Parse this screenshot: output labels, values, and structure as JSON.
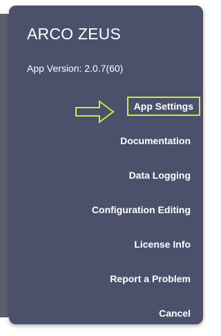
{
  "dialog": {
    "title": "ARCO ZEUS",
    "version": "App Version: 2.0.7(60)"
  },
  "menu": {
    "items": [
      {
        "label": "App Settings"
      },
      {
        "label": "Documentation"
      },
      {
        "label": "Data Logging"
      },
      {
        "label": "Configuration Editing"
      },
      {
        "label": "License Info"
      },
      {
        "label": "Report a Problem"
      },
      {
        "label": "Cancel"
      }
    ]
  },
  "annotation": {
    "arrow_icon": "right-arrow-icon",
    "highlight_color": "#c6ec3f"
  },
  "colors": {
    "dialog_background": "#4b506b",
    "text": "#ffffff"
  }
}
